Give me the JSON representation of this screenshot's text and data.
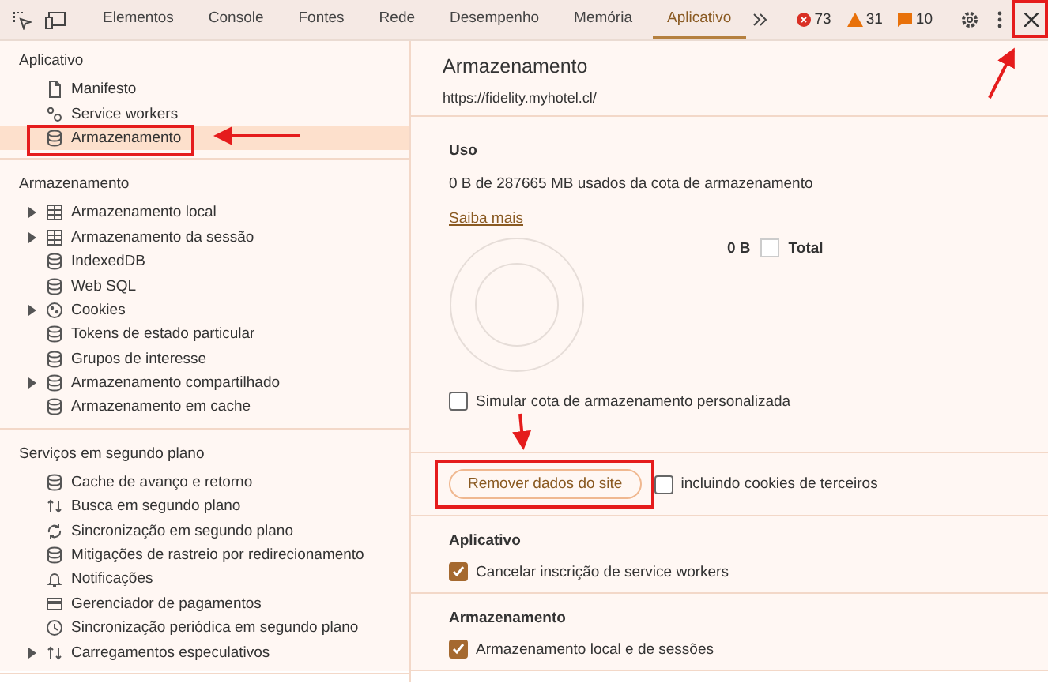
{
  "toolbar": {
    "tabs": [
      {
        "label": "Elementos",
        "selected": false
      },
      {
        "label": "Console",
        "selected": false
      },
      {
        "label": "Fontes",
        "selected": false
      },
      {
        "label": "Rede",
        "selected": false
      },
      {
        "label": "Desempenho",
        "selected": false
      },
      {
        "label": "Memória",
        "selected": false
      },
      {
        "label": "Aplicativo",
        "selected": true
      }
    ],
    "errors": "73",
    "warnings": "31",
    "issues": "10"
  },
  "sidebar": {
    "sections": [
      {
        "title": "Aplicativo",
        "items": [
          {
            "label": "Manifesto",
            "kind": "file",
            "expandable": false,
            "selected": false
          },
          {
            "label": "Service workers",
            "kind": "gears",
            "expandable": false,
            "selected": false
          },
          {
            "label": "Armazenamento",
            "kind": "db",
            "expandable": false,
            "selected": true
          }
        ]
      },
      {
        "title": "Armazenamento",
        "items": [
          {
            "label": "Armazenamento local",
            "kind": "grid",
            "expandable": true,
            "selected": false
          },
          {
            "label": "Armazenamento da sessão",
            "kind": "grid",
            "expandable": true,
            "selected": false
          },
          {
            "label": "IndexedDB",
            "kind": "db",
            "expandable": false,
            "selected": false
          },
          {
            "label": "Web SQL",
            "kind": "db",
            "expandable": false,
            "selected": false
          },
          {
            "label": "Cookies",
            "kind": "cookie",
            "expandable": true,
            "selected": false
          },
          {
            "label": "Tokens de estado particular",
            "kind": "db",
            "expandable": false,
            "selected": false
          },
          {
            "label": "Grupos de interesse",
            "kind": "db",
            "expandable": false,
            "selected": false
          },
          {
            "label": "Armazenamento compartilhado",
            "kind": "db",
            "expandable": true,
            "selected": false
          },
          {
            "label": "Armazenamento em cache",
            "kind": "db",
            "expandable": false,
            "selected": false
          }
        ]
      },
      {
        "title": "Serviços em segundo plano",
        "items": [
          {
            "label": "Cache de avanço e retorno",
            "kind": "db",
            "expandable": false,
            "selected": false
          },
          {
            "label": "Busca em segundo plano",
            "kind": "updown",
            "expandable": false,
            "selected": false
          },
          {
            "label": "Sincronização em segundo plano",
            "kind": "sync",
            "expandable": false,
            "selected": false
          },
          {
            "label": "Mitigações de rastreio por redirecionamento",
            "kind": "db",
            "expandable": false,
            "selected": false
          },
          {
            "label": "Notificações",
            "kind": "bell",
            "expandable": false,
            "selected": false
          },
          {
            "label": "Gerenciador de pagamentos",
            "kind": "card",
            "expandable": false,
            "selected": false
          },
          {
            "label": "Sincronização periódica em segundo plano",
            "kind": "clock",
            "expandable": false,
            "selected": false
          },
          {
            "label": "Carregamentos especulativos",
            "kind": "updown",
            "expandable": true,
            "selected": false
          }
        ]
      }
    ]
  },
  "main": {
    "title": "Armazenamento",
    "origin": "https://fidelity.myhotel.cl/",
    "usage": {
      "heading": "Uso",
      "text": "0 B de 287665 MB usados da cota de armazenamento",
      "link": "Saiba mais",
      "legend_value": "0 B",
      "legend_label": "Total",
      "simulate": {
        "label": "Simular cota de armazenamento personalizada",
        "checked": false
      }
    },
    "clear_button": "Remover dados do site",
    "third_party": {
      "label": "incluindo cookies de terceiros",
      "checked": false
    },
    "groups": [
      {
        "title": "Aplicativo",
        "options": [
          {
            "label": "Cancelar inscrição de service workers",
            "checked": true
          }
        ]
      },
      {
        "title": "Armazenamento",
        "options": [
          {
            "label": "Armazenamento local e de sessões",
            "checked": true
          }
        ]
      }
    ]
  }
}
